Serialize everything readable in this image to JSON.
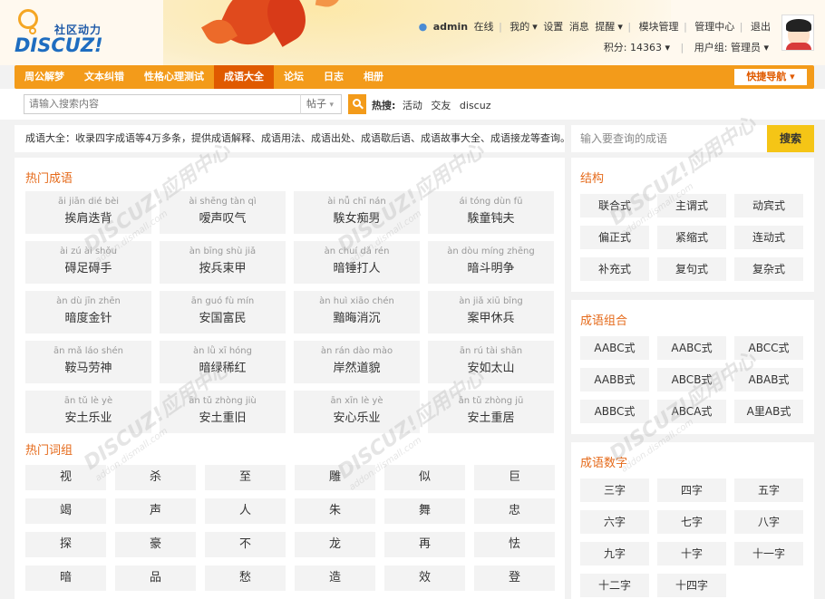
{
  "header": {
    "logo_tagline": "社区动力",
    "logo_brand": "DISCUZ!",
    "username": "admin",
    "online_status": "在线",
    "nav": [
      "我的",
      "设置",
      "消息",
      "提醒",
      "模块管理",
      "管理中心",
      "退出"
    ],
    "points_label": "积分: 14363",
    "group_label": "用户组: 管理员"
  },
  "mainnav": {
    "items": [
      "周公解梦",
      "文本纠错",
      "性格心理测试",
      "成语大全",
      "论坛",
      "日志",
      "相册"
    ],
    "active_index": 3,
    "quick_nav": "快捷导航"
  },
  "search": {
    "placeholder": "请输入搜索内容",
    "type_value": "帖子",
    "hot_label": "热搜:",
    "hot_terms": [
      "活动",
      "交友",
      "discuz"
    ]
  },
  "intro_text": "成语大全：收录四字成语等4万多条，提供成语解释、成语用法、成语出处、成语歇后语、成语故事大全、成语接龙等查询。",
  "query": {
    "placeholder": "输入要查询的成语",
    "button": "搜索"
  },
  "hot_idioms": {
    "title": "热门成语",
    "items": [
      {
        "py": "āi jiān dié bèi",
        "cn": "挨肩迭背"
      },
      {
        "py": "ài shēng tàn qì",
        "cn": "嗳声叹气"
      },
      {
        "py": "ài nǚ chī nán",
        "cn": "騃女痴男"
      },
      {
        "py": "ái tóng dùn fū",
        "cn": "騃童钝夫"
      },
      {
        "py": "ài zú ài shǒu",
        "cn": "碍足碍手"
      },
      {
        "py": "àn bīng shù jiǎ",
        "cn": "按兵束甲"
      },
      {
        "py": "àn chuí dǎ rén",
        "cn": "暗锤打人"
      },
      {
        "py": "àn dòu míng zhēng",
        "cn": "暗斗明争"
      },
      {
        "py": "àn dù jīn zhēn",
        "cn": "暗度金针"
      },
      {
        "py": "ān guó fù mín",
        "cn": "安国富民"
      },
      {
        "py": "àn huì xiāo chén",
        "cn": "黯晦消沉"
      },
      {
        "py": "àn jiǎ xiū bīng",
        "cn": "案甲休兵"
      },
      {
        "py": "ān mǎ láo shén",
        "cn": "鞍马劳神"
      },
      {
        "py": "àn lǜ xī hóng",
        "cn": "暗绿稀红"
      },
      {
        "py": "àn rán dào mào",
        "cn": "岸然道貌"
      },
      {
        "py": "ān rú tài shān",
        "cn": "安如太山"
      },
      {
        "py": "ān tǔ lè yè",
        "cn": "安土乐业"
      },
      {
        "py": "ān tǔ zhòng jiù",
        "cn": "安土重旧"
      },
      {
        "py": "ān xīn lè yè",
        "cn": "安心乐业"
      },
      {
        "py": "ān tǔ zhòng jū",
        "cn": "安土重居"
      }
    ]
  },
  "hot_words": {
    "title": "热门词组",
    "items": [
      "视",
      "杀",
      "至",
      "雕",
      "似",
      "巨",
      "竭",
      "声",
      "人",
      "朱",
      "舞",
      "忠",
      "探",
      "豪",
      "不",
      "龙",
      "再",
      "怯",
      "暗",
      "品",
      "愁",
      "造",
      "效",
      "登"
    ]
  },
  "structure": {
    "title": "结构",
    "items": [
      "联合式",
      "主谓式",
      "动宾式",
      "偏正式",
      "紧缩式",
      "连动式",
      "补充式",
      "复句式",
      "复杂式"
    ]
  },
  "combo": {
    "title": "成语组合",
    "items": [
      "AABC式",
      "AABC式",
      "ABCC式",
      "AABB式",
      "ABCB式",
      "ABAB式",
      "ABBC式",
      "ABCA式",
      "A里AB式"
    ]
  },
  "numbers": {
    "title": "成语数字",
    "items": [
      "三字",
      "四字",
      "五字",
      "六字",
      "七字",
      "八字",
      "九字",
      "十字",
      "十一字",
      "十二字",
      "十四字"
    ]
  },
  "watermark": {
    "brand": "DISCUZ!应用中心",
    "url": "addon.dismall.com",
    "tag": "贰道"
  }
}
